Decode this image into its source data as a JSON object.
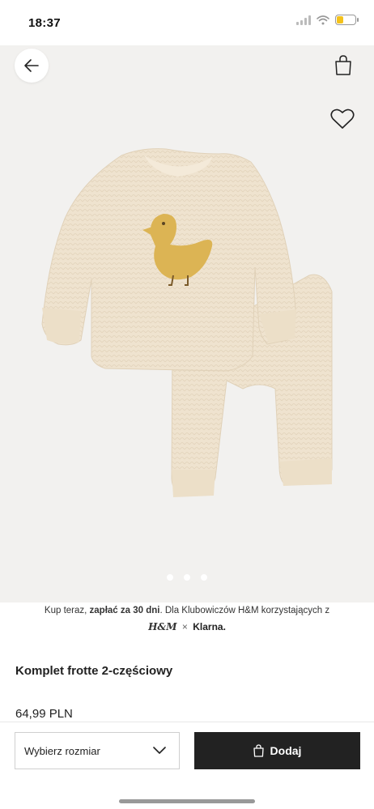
{
  "status_bar": {
    "time": "18:37",
    "battery_color": "#f4c21b"
  },
  "header": {
    "back_icon": "arrow-left-icon",
    "bag_icon": "shopping-bag-icon",
    "favorite_icon": "heart-outline-icon"
  },
  "gallery": {
    "slide_count": 3,
    "image_description_icon": "product-image"
  },
  "klarna": {
    "prefix": "Kup teraz, ",
    "bold": "zapłać za 30 dni",
    "suffix": ". Dla Klubowiczów H&M korzystających z",
    "brand_hm": "H&M",
    "brand_separator": "×",
    "brand_klarna": "Klarna."
  },
  "product": {
    "title": "Komplet frotte 2-częściowy",
    "price": "64,99 PLN"
  },
  "actions": {
    "size_label": "Wybierz rozmiar",
    "add_label": "Dodaj",
    "accent_color": "#222222"
  }
}
